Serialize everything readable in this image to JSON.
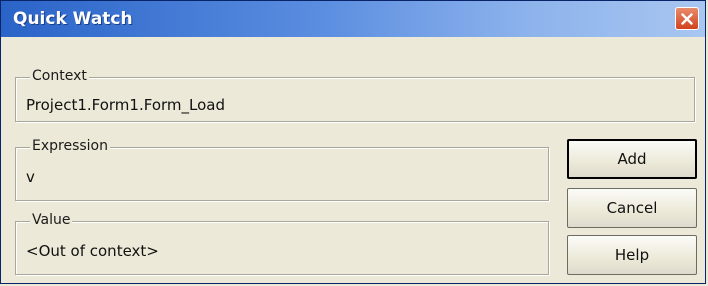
{
  "window": {
    "title": "Quick Watch",
    "close_icon": "close-icon"
  },
  "context": {
    "label": "Context",
    "value": "Project1.Form1.Form_Load"
  },
  "expression": {
    "label": "Expression",
    "value": "v"
  },
  "value_group": {
    "label": "Value",
    "value": "<Out of context>"
  },
  "buttons": {
    "add": "Add",
    "cancel": "Cancel",
    "help": "Help"
  },
  "colors": {
    "titlebar_start": "#2a64c8",
    "titlebar_end": "#a8c6f0",
    "close_button": "#d1431c",
    "dialog_background": "#ece9d8"
  }
}
